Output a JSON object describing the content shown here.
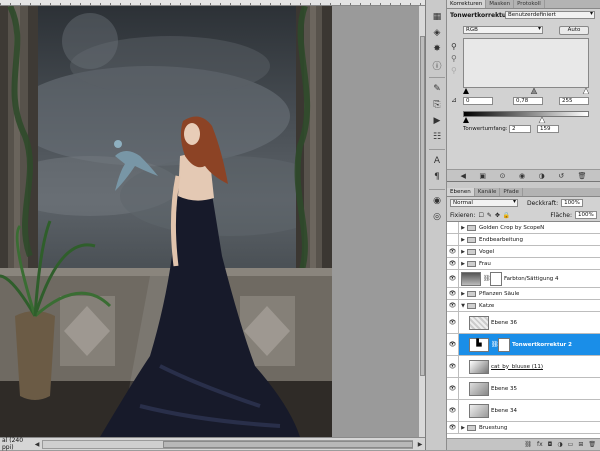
{
  "status_bar": {
    "zoom": "al (240 ppi)"
  },
  "adjustments_panel": {
    "tabs": [
      {
        "label": "Korrekturen",
        "active": true
      },
      {
        "label": "Masken",
        "active": false
      },
      {
        "label": "Protokoll",
        "active": false
      }
    ],
    "title": "Tonwertkorrektur",
    "preset": "Benutzerdefiniert",
    "channel": "RGB",
    "auto_label": "Auto",
    "input_black": "0",
    "input_gamma": "0,78",
    "input_white": "255",
    "output_label": "Tonwertumfang:",
    "output_black": "2",
    "output_white": "159"
  },
  "layers_panel": {
    "tabs": [
      {
        "label": "Ebenen",
        "active": true
      },
      {
        "label": "Kanäle",
        "active": false
      },
      {
        "label": "Pfade",
        "active": false
      }
    ],
    "blend_mode": "Normal",
    "opacity_label": "Deckkraft:",
    "opacity_value": "100%",
    "lock_label": "Fixieren:",
    "fill_label": "Fläche:",
    "fill_value": "100%",
    "layers": [
      {
        "name": "Golden Crop by ScopeN",
        "type": "group",
        "visible": false,
        "selected": false
      },
      {
        "name": "Endbearbeitung",
        "type": "group",
        "visible": false,
        "selected": false
      },
      {
        "name": "Vogel",
        "type": "group",
        "visible": true,
        "selected": false
      },
      {
        "name": "Frau",
        "type": "group",
        "visible": true,
        "selected": false
      },
      {
        "name": "Farbton/Sättigung 4",
        "type": "adjustment",
        "visible": true,
        "selected": false
      },
      {
        "name": "Pflanzen Säule",
        "type": "group",
        "visible": true,
        "selected": false
      },
      {
        "name": "Katze",
        "type": "group",
        "visible": true,
        "selected": false
      },
      {
        "name": "Ebene 36",
        "type": "layer",
        "visible": true,
        "selected": false
      },
      {
        "name": "Tonwertkorrektur 2",
        "type": "adjustment",
        "visible": true,
        "selected": true
      },
      {
        "name": "cat_by_bluuse (11)",
        "type": "layer",
        "visible": true,
        "selected": false
      },
      {
        "name": "Ebene 35",
        "type": "layer",
        "visible": true,
        "selected": false
      },
      {
        "name": "Ebene 34",
        "type": "layer",
        "visible": true,
        "selected": false
      },
      {
        "name": "Bruestung",
        "type": "group",
        "visible": true,
        "selected": false
      }
    ]
  }
}
